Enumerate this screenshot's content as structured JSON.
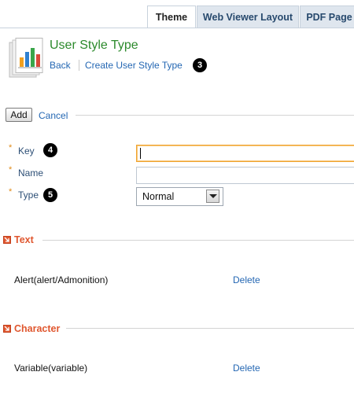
{
  "tabs": [
    {
      "label": "Theme",
      "active": true
    },
    {
      "label": "Web Viewer Layout",
      "active": false
    },
    {
      "label": "PDF Page",
      "active": false
    }
  ],
  "header": {
    "icon": "document-chart-icon",
    "title": "User Style Type",
    "back_label": "Back",
    "create_label": "Create User Style Type",
    "badge": "3"
  },
  "actions": {
    "add_label": "Add",
    "cancel_label": "Cancel"
  },
  "form": {
    "required_marker": "*",
    "key": {
      "label": "Key",
      "badge": "4",
      "value": ""
    },
    "name": {
      "label": "Name",
      "value": ""
    },
    "type": {
      "label": "Type",
      "badge": "5",
      "value": "Normal"
    }
  },
  "sections": [
    {
      "title": "Text",
      "rows": [
        {
          "text": "Alert(alert/Admonition)",
          "action": "Delete"
        }
      ]
    },
    {
      "title": "Character",
      "rows": [
        {
          "text": "Variable(variable)",
          "action": "Delete"
        }
      ]
    }
  ],
  "colors": {
    "title": "#2c8a2c",
    "link": "#2467b3",
    "section": "#e0572f",
    "required": "#e08a17",
    "focus_border": "#f0a430"
  }
}
